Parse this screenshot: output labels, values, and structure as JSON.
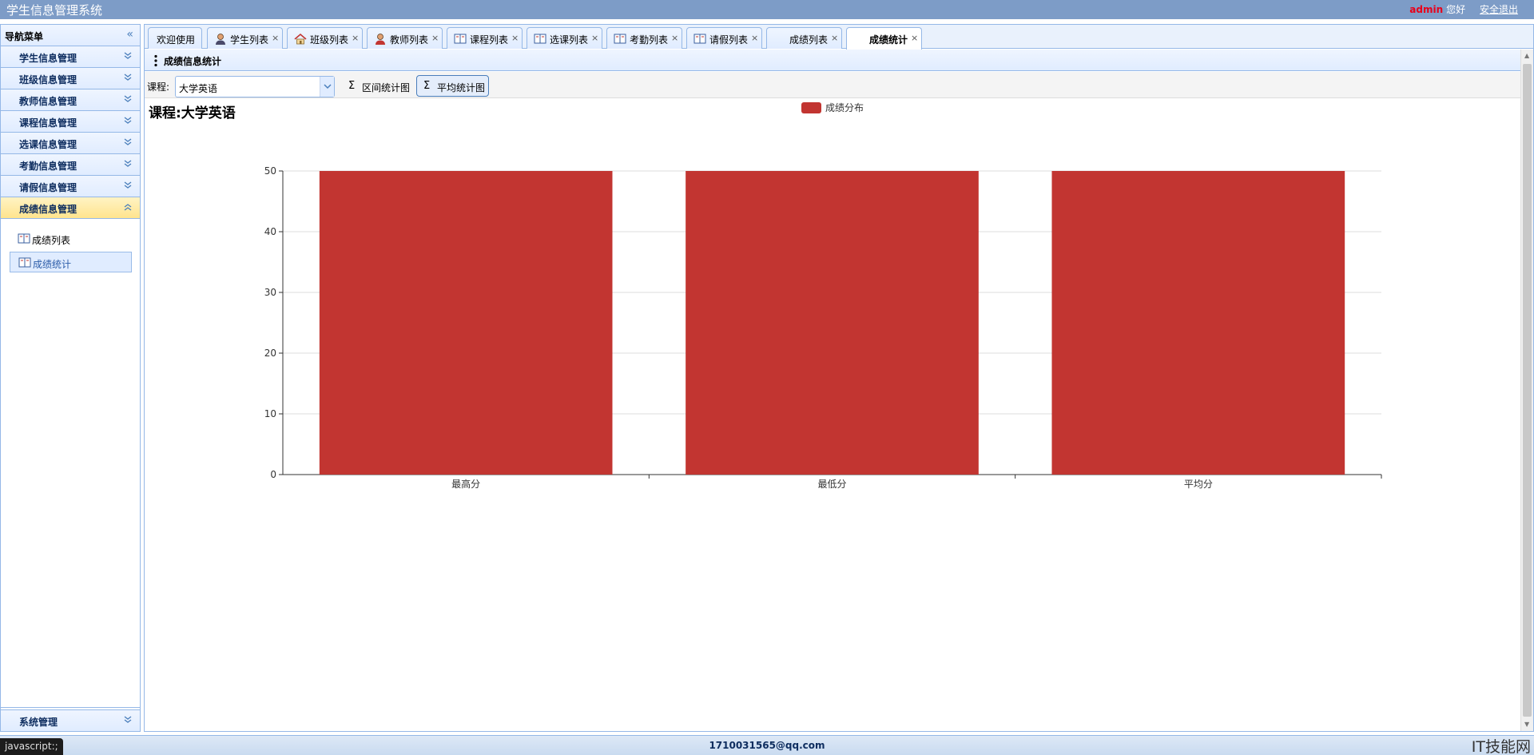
{
  "header": {
    "title": "学生信息管理系统",
    "user_name": "admin",
    "greeting": "您好",
    "logout": "安全退出"
  },
  "sidebar": {
    "title": "导航菜单",
    "groups": [
      {
        "label": "学生信息管理"
      },
      {
        "label": "班级信息管理"
      },
      {
        "label": "教师信息管理"
      },
      {
        "label": "课程信息管理"
      },
      {
        "label": "选课信息管理"
      },
      {
        "label": "考勤信息管理"
      },
      {
        "label": "请假信息管理"
      },
      {
        "label": "成绩信息管理"
      }
    ],
    "sub_items": [
      {
        "label": "成绩列表"
      },
      {
        "label": "成绩统计"
      }
    ],
    "bottom_group": "系统管理"
  },
  "tabs": [
    {
      "label": "欢迎使用",
      "icon": "none"
    },
    {
      "label": "学生列表",
      "icon": "user-icon"
    },
    {
      "label": "班级列表",
      "icon": "house-icon"
    },
    {
      "label": "教师列表",
      "icon": "user-red-icon"
    },
    {
      "label": "课程列表",
      "icon": "book-icon"
    },
    {
      "label": "选课列表",
      "icon": "book-icon"
    },
    {
      "label": "考勤列表",
      "icon": "book-icon"
    },
    {
      "label": "请假列表",
      "icon": "book-icon"
    },
    {
      "label": "成绩列表",
      "icon": "none"
    },
    {
      "label": "成绩统计",
      "icon": "none"
    }
  ],
  "panel": {
    "title": "成绩信息统计"
  },
  "toolbar": {
    "course_label": "课程:",
    "course_value": "大学英语",
    "range_chart": "区间统计图",
    "avg_chart": "平均统计图"
  },
  "chart_data": {
    "type": "bar",
    "title": "课程:大学英语",
    "categories": [
      "最高分",
      "最低分",
      "平均分"
    ],
    "series": [
      {
        "name": "成绩分布",
        "values": [
          50,
          50,
          50
        ],
        "color": "#c23531"
      }
    ],
    "ylim": [
      0,
      50
    ],
    "yticks": [
      0,
      10,
      20,
      30,
      40,
      50
    ],
    "grid": true,
    "legend": "top-center"
  },
  "footer": {
    "email": "1710031565@qq.com",
    "status": "javascript:;",
    "watermark": "IT技能网"
  },
  "colors": {
    "header_bg": "#7d9cc7",
    "accent": "#95b8e7",
    "active_group": "#ffe48d",
    "bar": "#c23531"
  }
}
